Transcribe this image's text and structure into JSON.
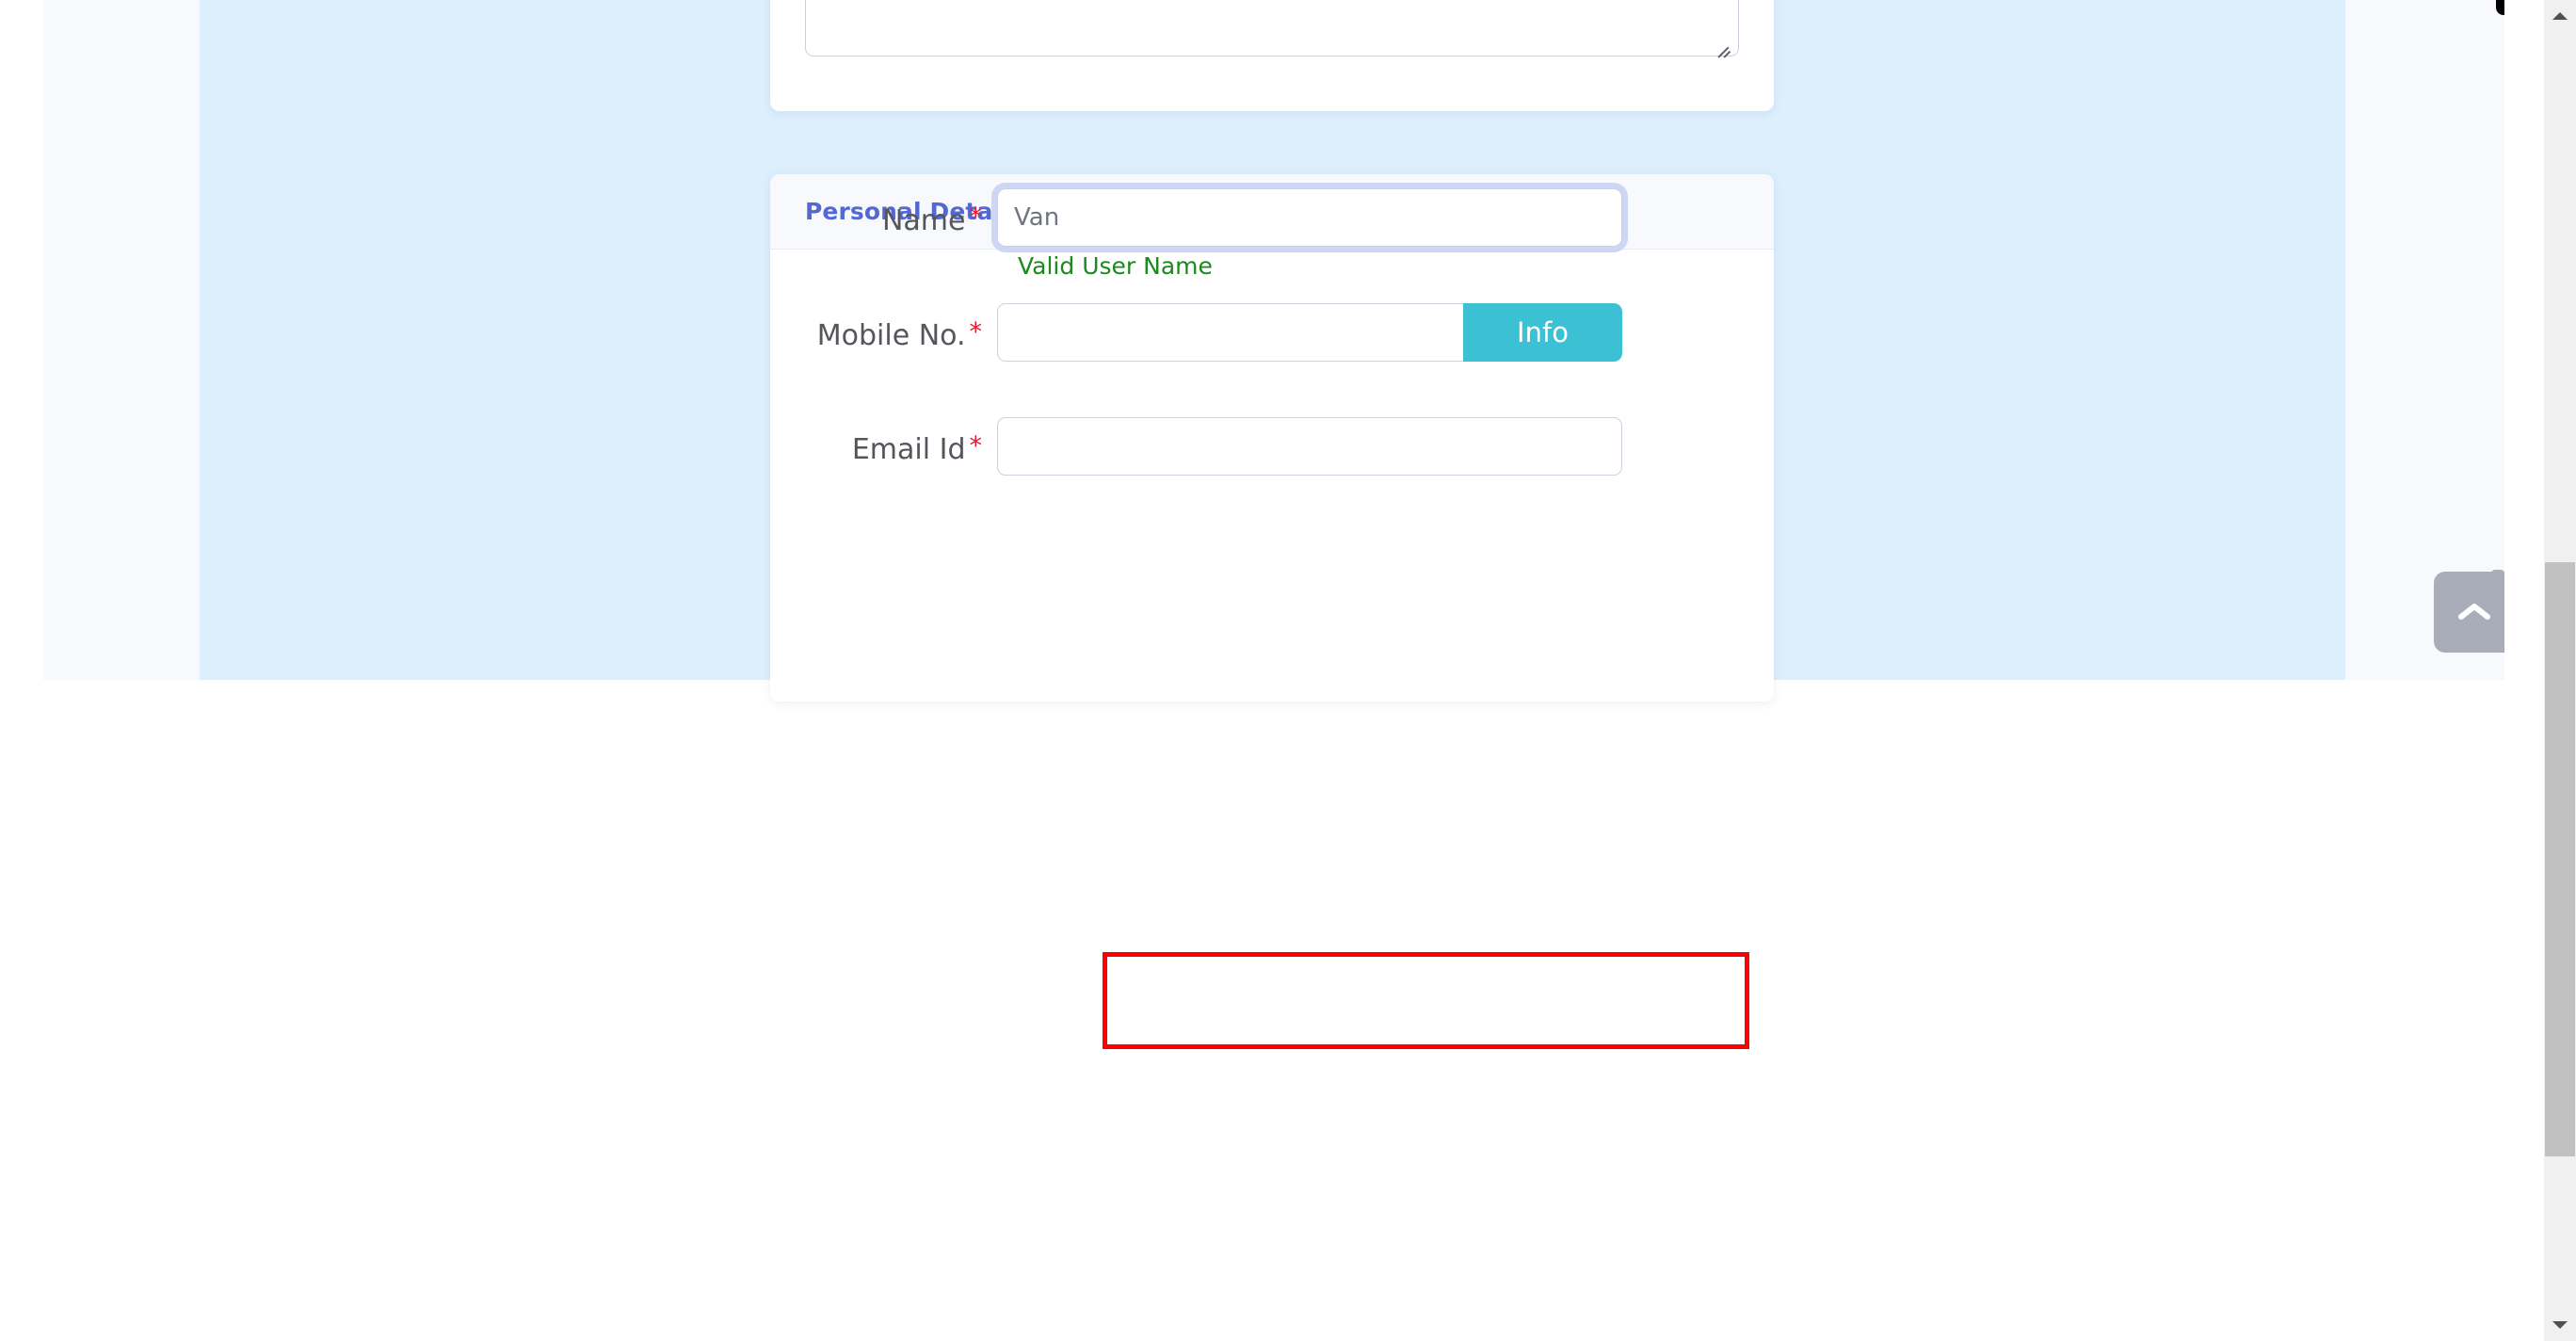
{
  "page": {
    "background_color": "#ffffff",
    "band_light_color": "#f7f9fd",
    "band_blue_color": "#ddeefc"
  },
  "top_card": {
    "textarea": {
      "value": "",
      "placeholder": "",
      "resize_grip_icon": "resize-grip-icon"
    }
  },
  "personal_details_card": {
    "header": {
      "title": "Personal Details",
      "title_color": "#5468d4"
    },
    "fields": [
      {
        "id": "name",
        "label": "Name",
        "required_marker": "*",
        "value": "Van",
        "placeholder": "Van",
        "focused": true,
        "helper_text": "Valid User Name",
        "helper_color": "#1a8b1c"
      },
      {
        "id": "mobile",
        "label": "Mobile No.",
        "required_marker": "*",
        "value": "",
        "placeholder": "",
        "focused": false,
        "button_label": "Info",
        "button_color": "#3cc0d4"
      },
      {
        "id": "email",
        "label": "Email Id",
        "required_marker": "*",
        "value": "",
        "placeholder": "",
        "focused": false
      }
    ]
  },
  "scroll_top_button": {
    "icon": "chevron-up-icon",
    "label": "",
    "color": "#a9acb9"
  },
  "annotation": {
    "shape": "rectangle",
    "color": "#ff0000",
    "border_width_px": 5,
    "text": ""
  },
  "scrollbars": {
    "browser": {
      "up_arrow_icon": "caret-up-icon",
      "down_arrow_icon": "caret-down-icon",
      "track_color": "#f0f0f0",
      "thumb_color": "#c1c1c1"
    },
    "inner": {
      "thumb_color": "#a9acb9"
    }
  }
}
